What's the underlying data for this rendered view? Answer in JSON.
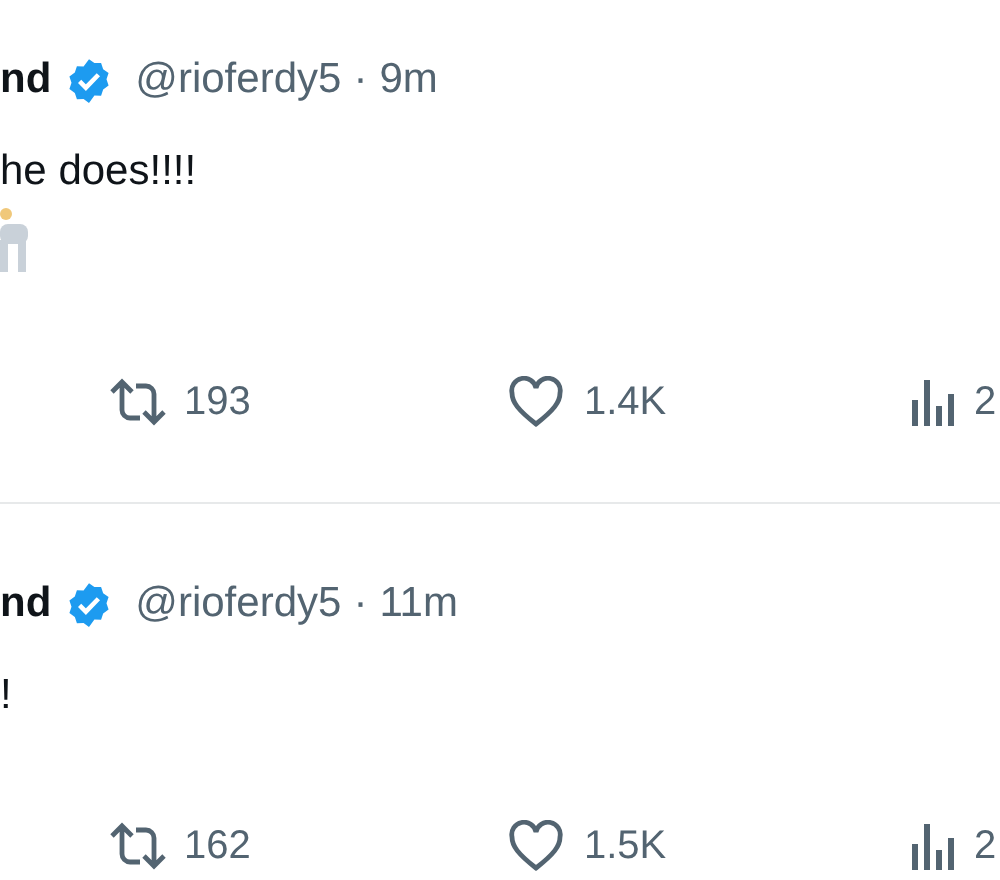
{
  "tweets": [
    {
      "name": "nd",
      "verified": true,
      "handle": "@rioferdy5",
      "separator": "·",
      "time": "9m",
      "text": "he does!!!!",
      "emoji": true,
      "retweets": "193",
      "likes": "1.4K",
      "views": "2"
    },
    {
      "name": "nd",
      "verified": true,
      "handle": "@rioferdy5",
      "separator": "·",
      "time": "11m",
      "text": "!",
      "retweets": "162",
      "likes": "1.5K",
      "views": "2"
    }
  ]
}
